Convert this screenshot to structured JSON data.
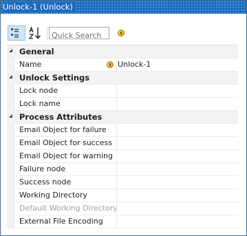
{
  "window": {
    "title": "Unlock-1 (Unlock)"
  },
  "toolbar": {
    "categorized_icon": "categorized-view-icon",
    "alphabetical_icon": "alphabetical-sort-icon",
    "search_placeholder": "Quick Search",
    "info_icon": "info-icon"
  },
  "categories": [
    {
      "label": "General",
      "properties": [
        {
          "name": "Name",
          "value": "Unlock-1",
          "value_icon": "info-icon",
          "disabled": false
        }
      ]
    },
    {
      "label": "Unlock Settings",
      "properties": [
        {
          "name": "Lock node",
          "value": "",
          "disabled": false
        },
        {
          "name": "Lock name",
          "value": "",
          "disabled": false
        }
      ]
    },
    {
      "label": "Process Attributes",
      "properties": [
        {
          "name": "Email Object for failure",
          "value": "",
          "disabled": false
        },
        {
          "name": "Email Object for success",
          "value": "",
          "disabled": false
        },
        {
          "name": "Email Object for warning",
          "value": "",
          "disabled": false
        },
        {
          "name": "Failure node",
          "value": "",
          "disabled": false
        },
        {
          "name": "Success node",
          "value": "",
          "disabled": false
        },
        {
          "name": "Working Directory",
          "value": "",
          "disabled": false
        },
        {
          "name": "Default Working Directory",
          "value": "",
          "disabled": true
        },
        {
          "name": "External File Encoding",
          "value": "",
          "disabled": false
        }
      ]
    }
  ],
  "colors": {
    "titlebar": "#1a6bbf",
    "category_background": "#f2f2f2",
    "disabled_text": "#a0a0a0",
    "info_icon": "#d19b16"
  }
}
